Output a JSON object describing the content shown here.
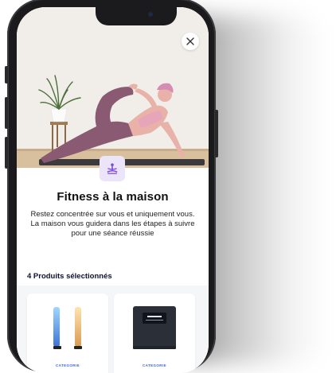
{
  "modal": {
    "title": "Fitness à la maison",
    "description": "Restez concentrée sur vous et uniquement vous. La maison vous guidera dans les étapes à suivre pour une séance réussie",
    "close_icon": "close-icon",
    "badge_icon": "meditation-icon"
  },
  "products": {
    "section_title": "4 Produits sélectionnés",
    "items": [
      {
        "category": "CATEGORIE",
        "icon": "light-bars-image"
      },
      {
        "category": "CATEGORIE",
        "icon": "smart-scale-image"
      }
    ]
  },
  "colors": {
    "accent": "#3a66d9",
    "badge_bg": "#ece5f9",
    "badge_icon": "#7a4be0",
    "title": "#111111"
  }
}
